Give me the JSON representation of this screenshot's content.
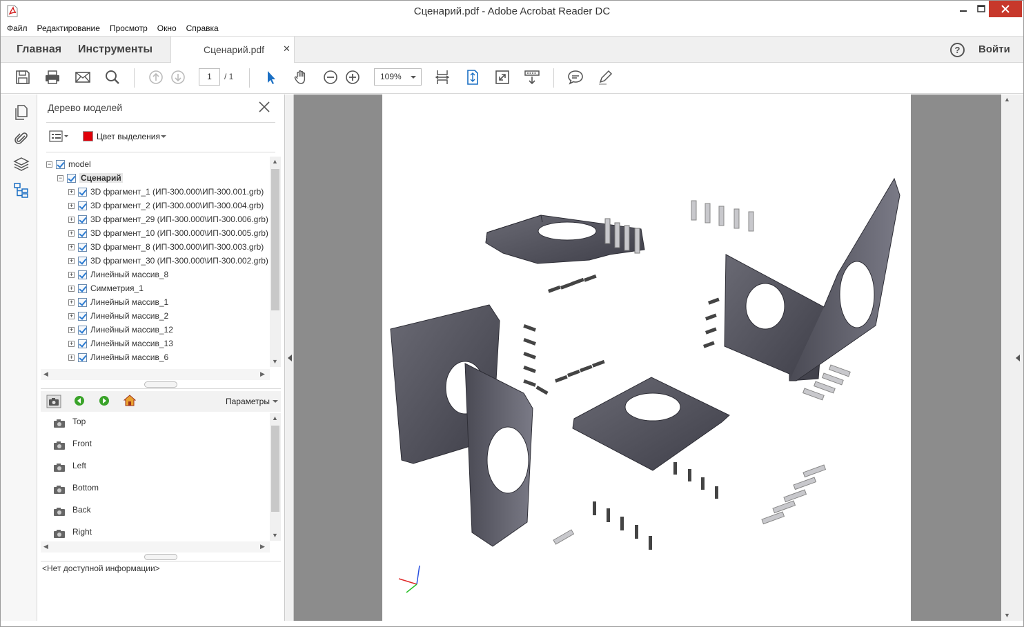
{
  "window": {
    "title": "Сценарий.pdf - Adobe Acrobat Reader DC"
  },
  "menu": [
    "Файл",
    "Редактирование",
    "Просмотр",
    "Окно",
    "Справка"
  ],
  "tabs": {
    "home": "Главная",
    "tools": "Инструменты",
    "document": "Сценарий.pdf",
    "signin": "Войти"
  },
  "toolbar": {
    "page_current": "1",
    "page_total": "/ 1",
    "zoom": "109%",
    "icons": [
      "save-icon",
      "print-icon",
      "email-icon",
      "search-icon",
      "page-up-icon",
      "page-down-icon",
      "select-cursor-icon",
      "hand-icon",
      "zoom-out-icon",
      "zoom-in-icon",
      "fit-width-icon",
      "fit-page-icon",
      "full-screen-icon",
      "read-mode-icon",
      "comment-icon",
      "highlight-icon"
    ]
  },
  "model_tree": {
    "title": "Дерево моделей",
    "highlight_color_label": "Цвет выделения",
    "highlight_color": "#e0000a",
    "nodes": [
      {
        "label": "model",
        "level": 0
      },
      {
        "label": "Сценарий",
        "level": 1,
        "bold": true
      },
      {
        "label": "3D фрагмент_1 (ИП-300.000\\ИП-300.001.grb)",
        "level": 2
      },
      {
        "label": "3D фрагмент_2 (ИП-300.000\\ИП-300.004.grb)",
        "level": 2
      },
      {
        "label": "3D фрагмент_29 (ИП-300.000\\ИП-300.006.grb)",
        "level": 2
      },
      {
        "label": "3D фрагмент_10 (ИП-300.000\\ИП-300.005.grb)",
        "level": 2
      },
      {
        "label": "3D фрагмент_8 (ИП-300.000\\ИП-300.003.grb)",
        "level": 2
      },
      {
        "label": "3D фрагмент_30 (ИП-300.000\\ИП-300.002.grb)",
        "level": 2
      },
      {
        "label": "Линейный массив_8",
        "level": 2
      },
      {
        "label": "Симметрия_1",
        "level": 2
      },
      {
        "label": "Линейный массив_1",
        "level": 2
      },
      {
        "label": "Линейный массив_2",
        "level": 2
      },
      {
        "label": "Линейный массив_12",
        "level": 2
      },
      {
        "label": "Линейный массив_13",
        "level": 2
      },
      {
        "label": "Линейный массив_6",
        "level": 2
      }
    ],
    "views_params": "Параметры",
    "views": [
      "Top",
      "Front",
      "Left",
      "Bottom",
      "Back",
      "Right"
    ],
    "info": "<Нет доступной информации>"
  }
}
